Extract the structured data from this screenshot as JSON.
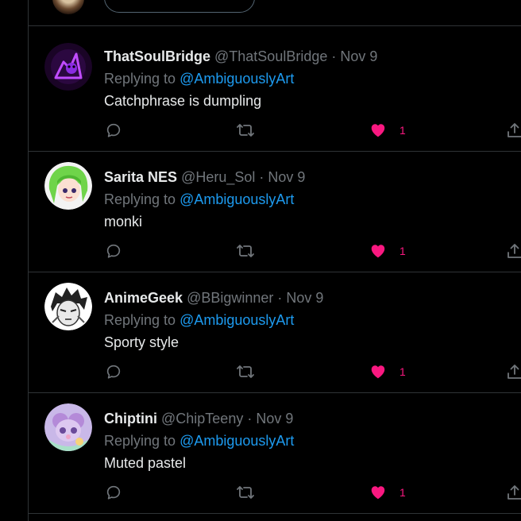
{
  "colors": {
    "background": "#000000",
    "border": "#2f3336",
    "name": "#e7e9ea",
    "muted": "#71767b",
    "link": "#1d9bf0",
    "like": "#f91880"
  },
  "replies": [
    {
      "display_name": "ThatSoulBridge",
      "handle": "@ThatSoulBridge",
      "separator": "·",
      "date": "Nov 9",
      "replying_prefix": "Replying to",
      "replying_to": "@AmbiguouslyArt",
      "text": "Catchphrase is dumpling",
      "likes": "1",
      "liked": true
    },
    {
      "display_name": "Sarita NES",
      "handle": "@Heru_Sol",
      "separator": "·",
      "date": "Nov 9",
      "replying_prefix": "Replying to",
      "replying_to": "@AmbiguouslyArt",
      "text": "monki",
      "likes": "1",
      "liked": true
    },
    {
      "display_name": "AnimeGeek",
      "handle": "@BBigwinner",
      "separator": "·",
      "date": "Nov 9",
      "replying_prefix": "Replying to",
      "replying_to": "@AmbiguouslyArt",
      "text": "Sporty style",
      "likes": "1",
      "liked": true
    },
    {
      "display_name": "Chiptini",
      "handle": "@ChipTeeny",
      "separator": "·",
      "date": "Nov 9",
      "replying_prefix": "Replying to",
      "replying_to": "@AmbiguouslyArt",
      "text": "Muted pastel",
      "likes": "1",
      "liked": true
    }
  ],
  "icons": {
    "reply": "reply-icon",
    "retweet": "retweet-icon",
    "like": "heart-icon",
    "share": "share-icon"
  }
}
